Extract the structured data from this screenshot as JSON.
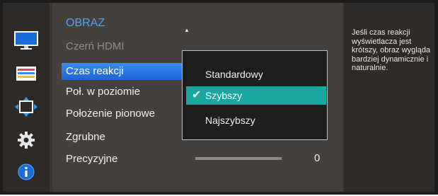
{
  "menu": {
    "title": "OBRAZ",
    "scroll_up": "▲",
    "items": [
      {
        "label": "Czerń HDMI"
      },
      {
        "label": "Czas reakcji"
      },
      {
        "label": "Poł. w poziomie"
      },
      {
        "label": "Położenie pionowe"
      },
      {
        "label": "Zgrubne"
      },
      {
        "label": "Precyzyjne"
      }
    ]
  },
  "dropdown": {
    "options": [
      "Standardowy",
      "Szybszy",
      "Najszybszy"
    ],
    "selected": "Szybszy",
    "check": "✔"
  },
  "slider": {
    "value": "0"
  },
  "description": "Jeśli czas reakcji wyświetlacza jest krótszy, obraz wygląda bardziej dynamicznie i naturalnie.",
  "sidebar_icons": [
    "monitor-icon",
    "color-bars-icon",
    "resize-arrows-icon",
    "gear-icon",
    "info-icon"
  ],
  "colors": {
    "title_blue": "#4fa3ff",
    "selection_blue": "#2a78e4",
    "option_teal": "#18a8a0",
    "monitor_blue": "#1a6cd8"
  }
}
